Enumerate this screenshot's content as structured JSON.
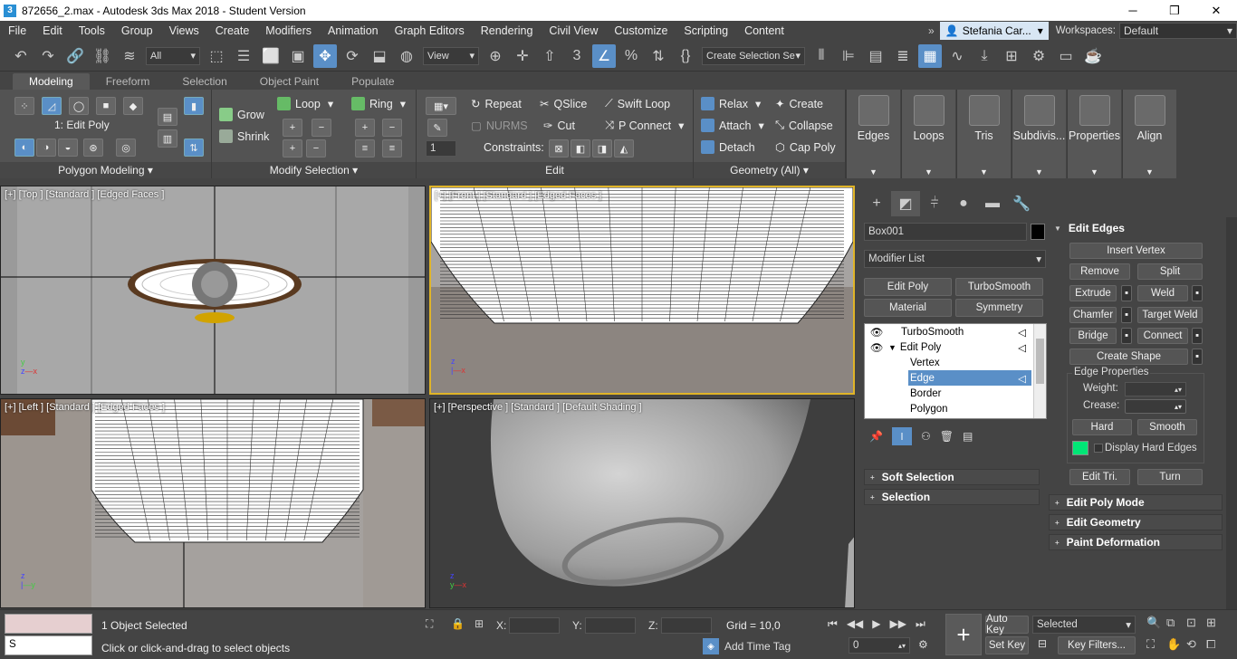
{
  "window": {
    "title": "872656_2.max - Autodesk 3ds Max 2018 - Student Version",
    "app_icon": "3ds-max-icon",
    "minimize": "─",
    "restore": "❐",
    "close": "✕"
  },
  "menu": {
    "items": [
      "File",
      "Edit",
      "Tools",
      "Group",
      "Views",
      "Create",
      "Modifiers",
      "Animation",
      "Graph Editors",
      "Rendering",
      "Civil View",
      "Customize",
      "Scripting",
      "Content"
    ],
    "overflow": "»",
    "user": "Stefania Car...",
    "workspaces_label": "Workspaces:",
    "workspace": "Default"
  },
  "toolbar": {
    "filter": "All",
    "ref_coord": "View",
    "selection_set": "Create Selection Se"
  },
  "ribbon": {
    "tabs": [
      "Modeling",
      "Freeform",
      "Selection",
      "Object Paint",
      "Populate"
    ],
    "active_tab": "Modeling",
    "polygon_modeling": {
      "title": "Polygon Modeling",
      "level": "1: Edit Poly"
    },
    "modify_selection": {
      "title": "Modify Selection",
      "grow": "Grow",
      "shrink": "Shrink",
      "loop": "Loop",
      "ring": "Ring"
    },
    "edit": {
      "title": "Edit",
      "repeat": "Repeat",
      "qslice": "QSlice",
      "swift_loop": "Swift Loop",
      "nurms": "NURMS",
      "cut": "Cut",
      "p_connect": "P Connect",
      "constraints": "Constraints:",
      "spinner": "1"
    },
    "geometry": {
      "title": "Geometry (All)",
      "relax": "Relax",
      "create": "Create",
      "attach": "Attach",
      "collapse": "Collapse",
      "detach": "Detach",
      "cap_poly": "Cap Poly"
    },
    "big_tools": [
      "Edges",
      "Loops",
      "Tris",
      "Subdivis...",
      "Properties",
      "Align"
    ]
  },
  "viewports": {
    "top": "[+] [Top ] [Standard ] [Edged Faces ]",
    "front": "[+] [Front ] [Standard ] [Edged Faces ]",
    "left": "[+] [Left ] [Standard ] [Edged Faces ]",
    "perspective": "[+] [Perspective ] [Standard ] [Default Shading ]"
  },
  "command_panel": {
    "object_name": "Box001",
    "modifier_list": "Modifier List",
    "mod_buttons": [
      "Edit Poly",
      "TurboSmooth",
      "Material",
      "Symmetry"
    ],
    "stack": [
      {
        "label": "TurboSmooth"
      },
      {
        "label": "Edit Poly"
      },
      {
        "label": "Vertex"
      },
      {
        "label": "Edge"
      },
      {
        "label": "Border"
      },
      {
        "label": "Polygon"
      }
    ],
    "selected_stack_item": "Edge",
    "rollouts_left": [
      "Soft Selection",
      "Selection"
    ],
    "edit_edges": {
      "title": "Edit Edges",
      "insert_vertex": "Insert Vertex",
      "remove": "Remove",
      "split": "Split",
      "extrude": "Extrude",
      "weld": "Weld",
      "chamfer": "Chamfer",
      "target_weld": "Target Weld",
      "bridge": "Bridge",
      "connect": "Connect",
      "create_shape": "Create Shape",
      "edge_properties": "Edge Properties",
      "weight": "Weight:",
      "crease": "Crease:",
      "hard": "Hard",
      "smooth": "Smooth",
      "display_hard_edges": "Display Hard Edges",
      "edit_tri": "Edit Tri.",
      "turn": "Turn",
      "hard_edge_color": "#00e676"
    },
    "rollouts_right": [
      "Edit Poly Mode",
      "Edit Geometry",
      "Paint Deformation"
    ]
  },
  "status": {
    "script_input": "S",
    "selected": "1 Object Selected",
    "prompt": "Click or click-and-drag to select objects",
    "x_label": "X:",
    "y_label": "Y:",
    "z_label": "Z:",
    "grid": "Grid = 10,0",
    "add_time_tag": "Add Time Tag",
    "auto_key": "Auto Key",
    "set_key": "Set Key",
    "key_mode": "Selected",
    "frame": "0",
    "key_filters": "Key Filters..."
  }
}
